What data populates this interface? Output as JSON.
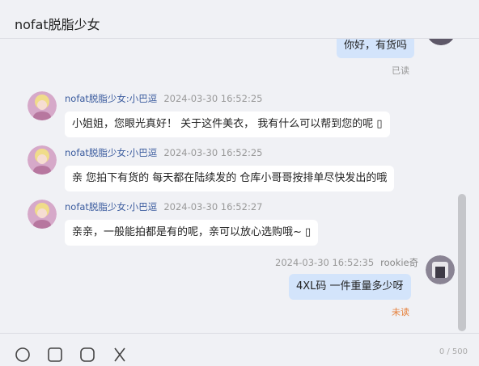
{
  "header": {
    "title": "nofat脱脂少女"
  },
  "messages": [
    {
      "text": "你好，有货吗",
      "status": "已读"
    },
    {
      "sender": "nofat脱脂少女:小巴逗",
      "time": "2024-03-30 16:52:25",
      "text": "小姐姐，您眼光真好！  关于这件美衣， 我有什么可以帮到您的呢 ▯"
    },
    {
      "sender": "nofat脱脂少女:小巴逗",
      "time": "2024-03-30 16:52:25",
      "text": "亲 您拍下有货的 每天都在陆续发的 仓库小哥哥按排单尽快发出的哦"
    },
    {
      "sender": "nofat脱脂少女:小巴逗",
      "time": "2024-03-30 16:52:27",
      "text": "亲亲，一般能拍都是有的呢，亲可以放心选购哦~ ▯"
    },
    {
      "sender": "rookie奇",
      "time": "2024-03-30 16:52:35",
      "text": "4XL码  一件重量多少呀",
      "status": "未读"
    }
  ],
  "footer": {
    "counter": "0 / 500"
  },
  "icons": [
    "emoji-icon",
    "image-icon",
    "video-icon",
    "scissors-icon"
  ],
  "colors": {
    "outgoing_bubble": "#d3e4fb",
    "incoming_bubble": "#ffffff",
    "unread": "#e6803a",
    "sender_name": "#3a5b9e"
  }
}
